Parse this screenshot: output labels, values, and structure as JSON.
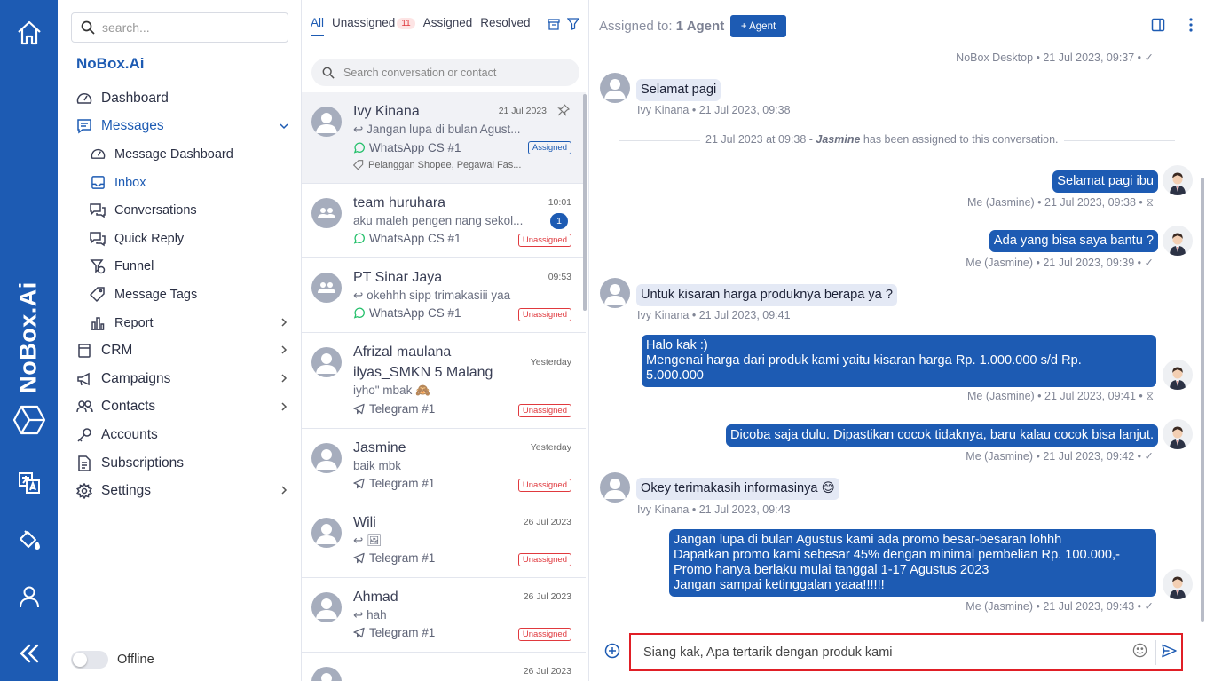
{
  "nav": {
    "search_placeholder": "search...",
    "brand": "NoBox.Ai",
    "items": [
      {
        "label": "Dashboard"
      },
      {
        "label": "Messages"
      },
      {
        "label": "Message Dashboard"
      },
      {
        "label": "Inbox"
      },
      {
        "label": "Conversations"
      },
      {
        "label": "Quick Reply"
      },
      {
        "label": "Funnel"
      },
      {
        "label": "Message Tags"
      },
      {
        "label": "Report"
      },
      {
        "label": "CRM"
      },
      {
        "label": "Campaigns"
      },
      {
        "label": "Contacts"
      },
      {
        "label": "Accounts"
      },
      {
        "label": "Subscriptions"
      },
      {
        "label": "Settings"
      }
    ],
    "offline_label": "Offline"
  },
  "rail": {
    "brand": "NoBox.Ai"
  },
  "list": {
    "tabs": [
      {
        "label": "All"
      },
      {
        "label": "Unassigned",
        "badge": "11"
      },
      {
        "label": "Assigned"
      },
      {
        "label": "Resolved"
      }
    ],
    "search_placeholder": "Search conversation or contact",
    "conversations": [
      {
        "name": "Ivy Kinana",
        "time": "21 Jul 2023",
        "preview": "Jangan lupa di bulan Agust...",
        "channel": "WhatsApp CS #1",
        "status": "Assigned",
        "tags": "Pelanggan Shopee, Pegawai Fas..."
      },
      {
        "name": "team huruhara",
        "time": "10:01",
        "preview": "aku maleh pengen nang sekol...",
        "channel": "WhatsApp CS #1",
        "status": "Unassigned",
        "unread": "1"
      },
      {
        "name": "PT Sinar Jaya",
        "time": "09:53",
        "preview": "okehhh sipp trimakasiii yaa",
        "channel": "WhatsApp CS #1",
        "status": "Unassigned"
      },
      {
        "name": "Afrizal maulana ilyas_SMKN 5 Malang",
        "time": "Yesterday",
        "preview": "iyho\" mbak 🙈",
        "channel": "Telegram #1",
        "status": "Unassigned"
      },
      {
        "name": "Jasmine",
        "time": "Yesterday",
        "preview": "baik mbk",
        "channel": "Telegram #1",
        "status": "Unassigned"
      },
      {
        "name": "Wili",
        "time": "26 Jul 2023",
        "preview": "🖼",
        "channel": "Telegram #1",
        "status": "Unassigned"
      },
      {
        "name": "Ahmad",
        "time": "26 Jul 2023",
        "preview": "hah",
        "channel": "Telegram #1",
        "status": "Unassigned"
      },
      {
        "name": "",
        "time": "26 Jul 2023"
      }
    ]
  },
  "chat": {
    "assigned_prefix": "Assigned to:",
    "assigned_value": "1 Agent",
    "add_agent_label": "+ Agent",
    "top_meta": "NoBox Desktop • 21 Jul 2023, 09:37 • ✓",
    "system": {
      "text_before": "21 Jul 2023 at 09:38 - ",
      "agent": "Jasmine",
      "text_after": " has been assigned to this conversation."
    },
    "messages": [
      {
        "dir": "in",
        "text": "Selamat pagi",
        "meta": "Ivy Kinana • 21 Jul 2023, 09:38"
      },
      {
        "dir": "out",
        "text": "Selamat pagi ibu",
        "meta": "Me (Jasmine) • 21 Jul 2023, 09:38 • ⧖"
      },
      {
        "dir": "out",
        "text": "Ada yang bisa saya bantu ?",
        "meta": "Me (Jasmine) • 21 Jul 2023, 09:39 • ✓"
      },
      {
        "dir": "in",
        "text": "Untuk kisaran harga produknya berapa ya ?",
        "meta": "Ivy Kinana • 21 Jul 2023, 09:41"
      },
      {
        "dir": "out",
        "text": "Halo kak :)\nMengenai harga dari produk kami yaitu kisaran harga Rp. 1.000.000 s/d Rp.\n5.000.000",
        "meta": "Me (Jasmine) • 21 Jul 2023, 09:41 • ⧖"
      },
      {
        "dir": "out",
        "text": "Dicoba saja dulu. Dipastikan cocok tidaknya, baru kalau cocok bisa lanjut.",
        "meta": "Me (Jasmine) • 21 Jul 2023, 09:42 • ✓"
      },
      {
        "dir": "in",
        "text": "Okey terimakasih informasinya 😊",
        "meta": "Ivy Kinana • 21 Jul 2023, 09:43"
      },
      {
        "dir": "out",
        "text": "Jangan lupa di bulan Agustus kami ada promo besar-besaran lohhh\nDapatkan promo kami sebesar 45% dengan minimal pembelian Rp. 100.000,-\nPromo hanya berlaku mulai tanggal 1-17 Agustus 2023\nJangan sampai ketinggalan yaaa!!!!!!",
        "meta": "Me (Jasmine) • 21 Jul 2023, 09:43 • ✓"
      }
    ],
    "composer_value": "Siang kak, Apa tertarik dengan produk kami"
  },
  "colors": {
    "brand": "#1d5bb3",
    "danger": "#e0393e",
    "incoming_bubble": "#e4e9f5",
    "outgoing_bubble": "#1d5bb3"
  }
}
